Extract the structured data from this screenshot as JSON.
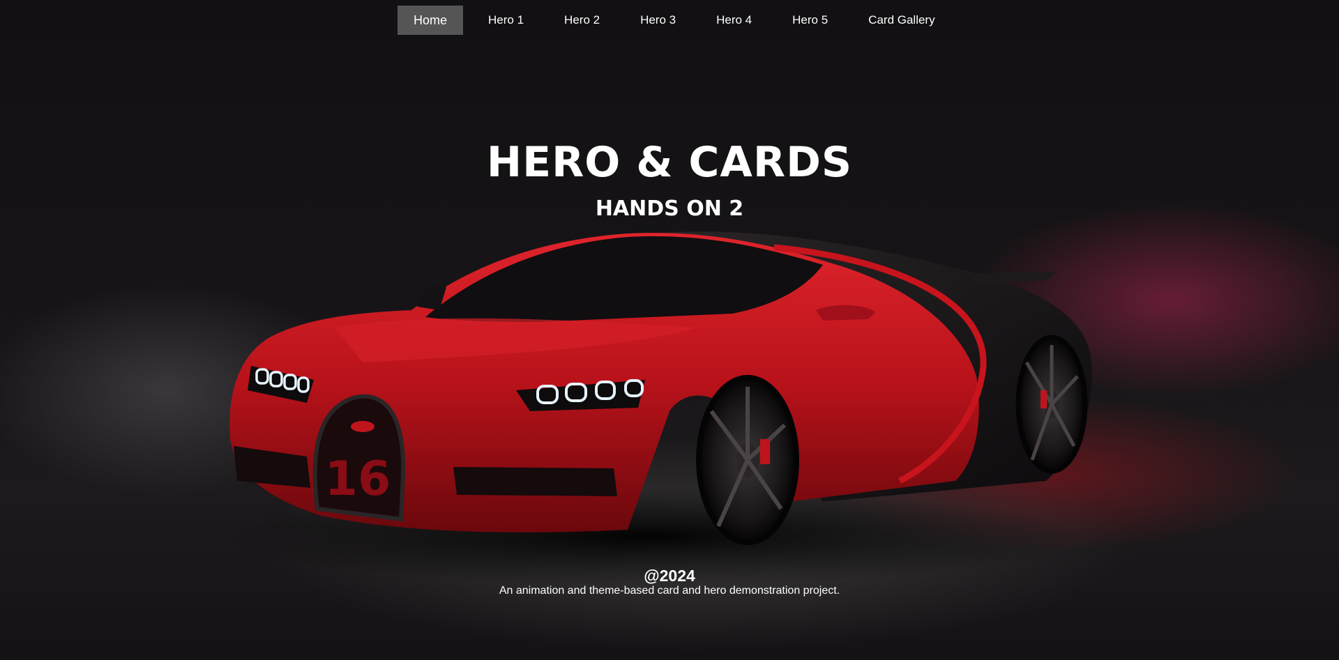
{
  "nav": {
    "items": [
      {
        "label": "Home",
        "active": true
      },
      {
        "label": "Hero 1",
        "active": false
      },
      {
        "label": "Hero 2",
        "active": false
      },
      {
        "label": "Hero 3",
        "active": false
      },
      {
        "label": "Hero 4",
        "active": false
      },
      {
        "label": "Hero 5",
        "active": false
      },
      {
        "label": "Card Gallery",
        "active": false
      }
    ]
  },
  "hero": {
    "title": "HERO & CARDS",
    "subtitle": "HANDS ON 2",
    "grille_badge": "16"
  },
  "footer": {
    "year": "@2024",
    "description": "An animation and theme-based card and hero demonstration project."
  },
  "colors": {
    "background": "#121113",
    "nav_active": "#555555",
    "car_red": "#c0141c",
    "car_black": "#141214",
    "text": "#ffffff"
  }
}
